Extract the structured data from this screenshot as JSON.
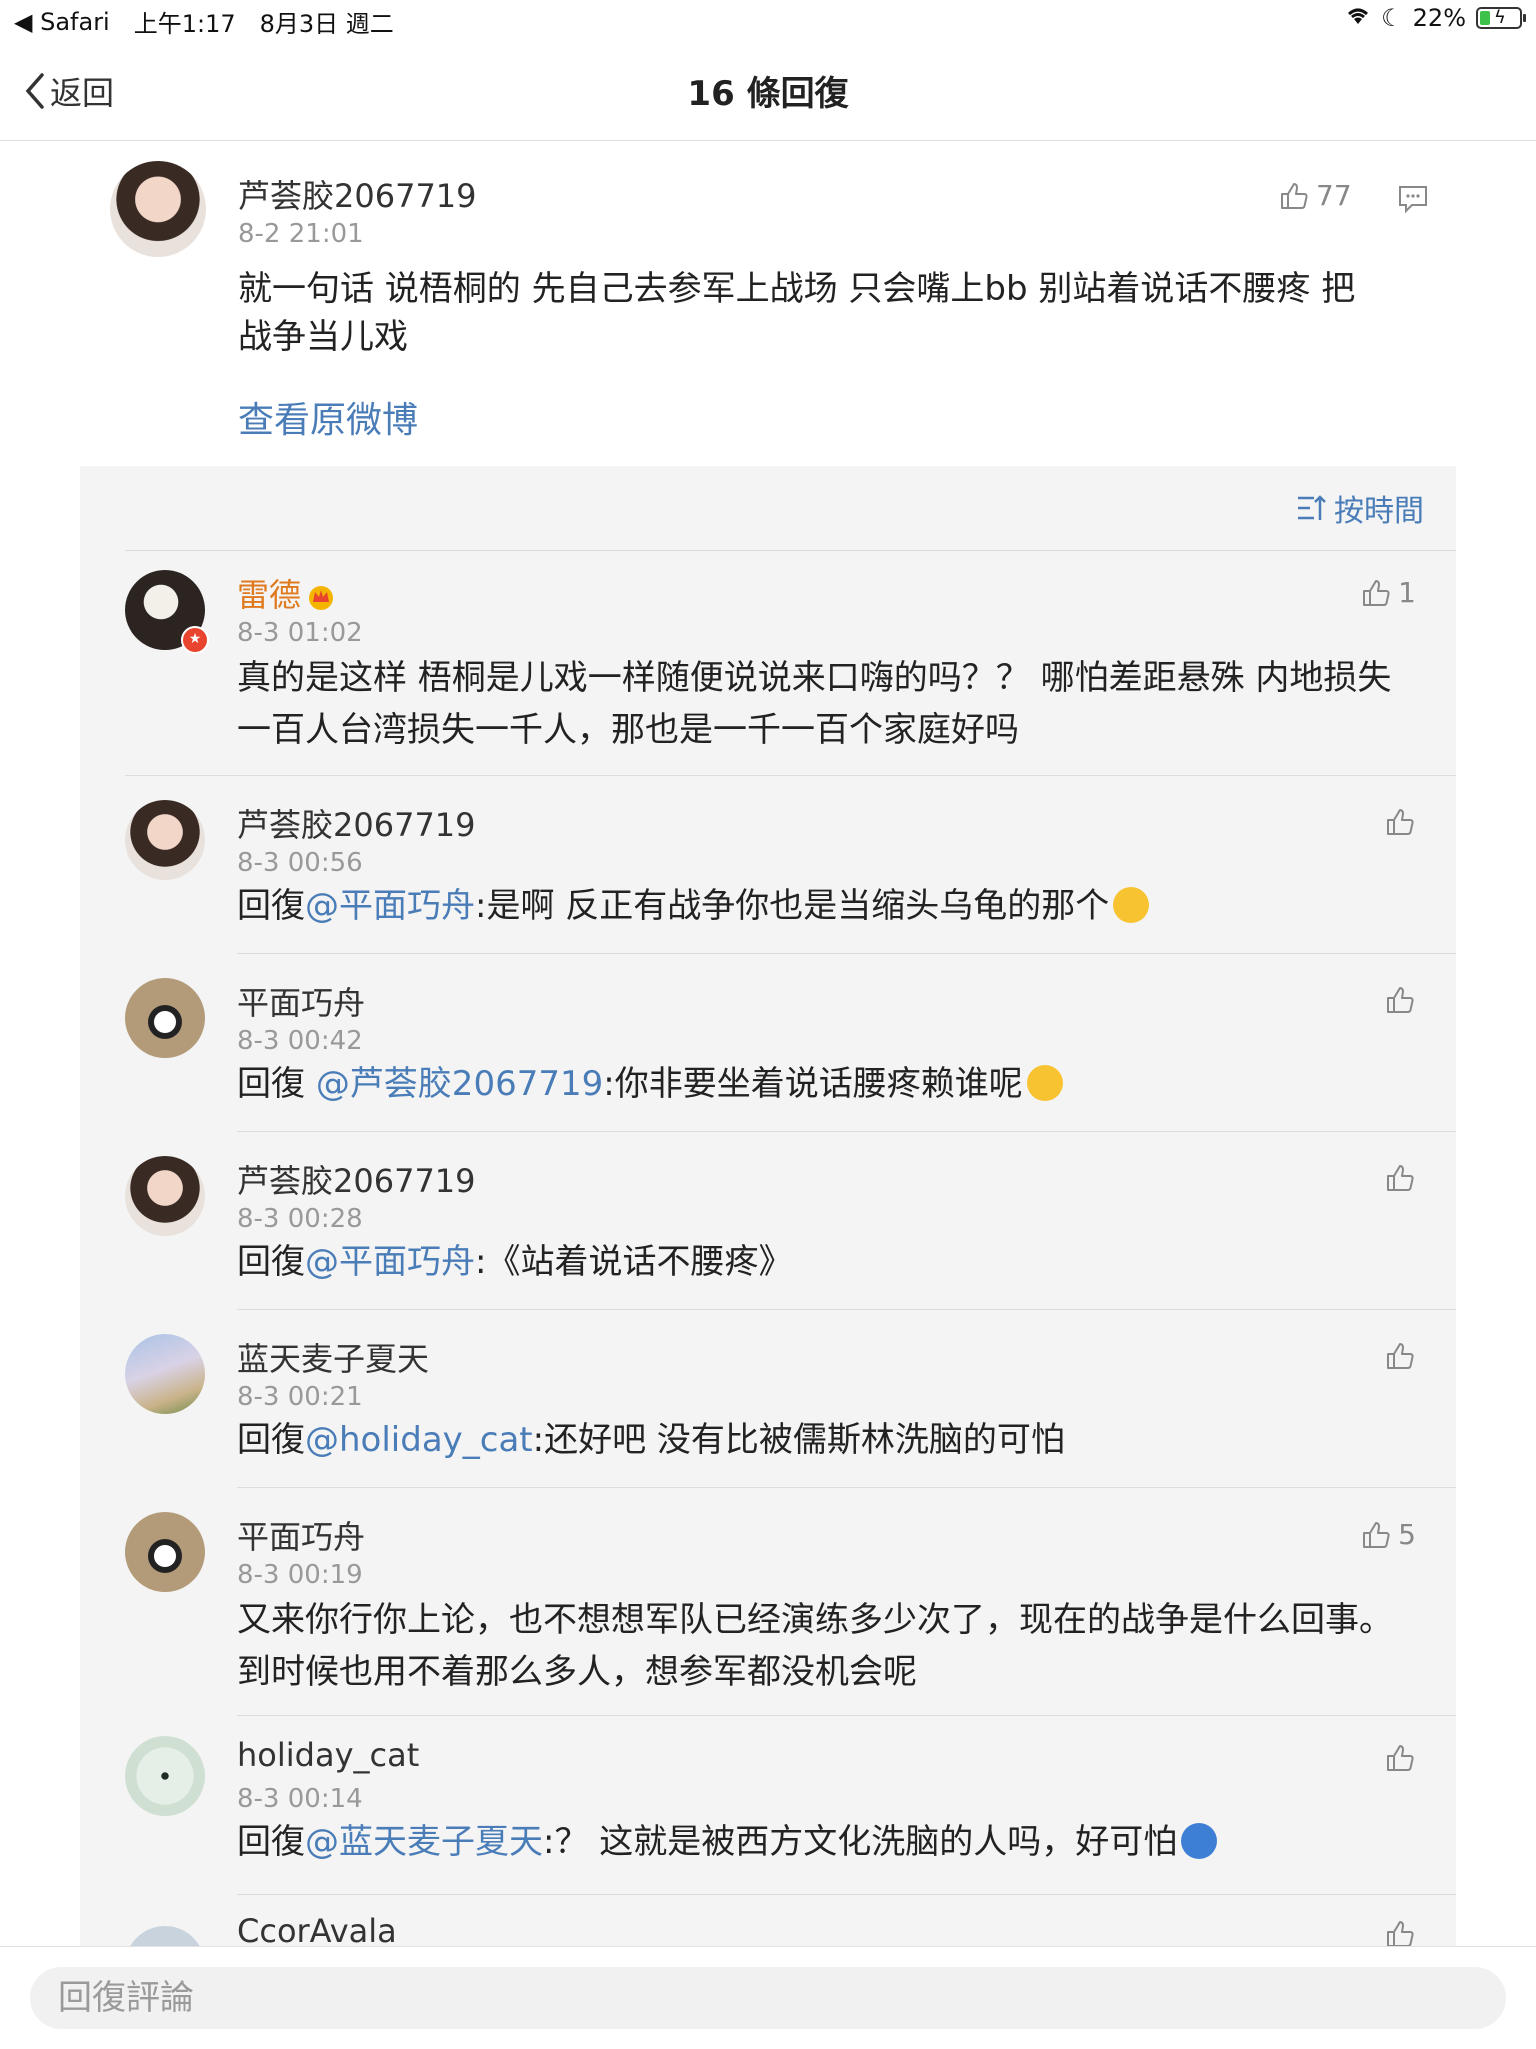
{
  "status_bar": {
    "app": "Safari",
    "time": "上午1:17",
    "date": "8月3日 週二",
    "battery": "22%"
  },
  "nav": {
    "back_label": "返回",
    "title": "16 條回復"
  },
  "main_comment": {
    "username": "芦荟胶2067719",
    "time": "8-2 21:01",
    "likes": "77",
    "text": "就一句话 说梧桐的 先自己去参军上战场 只会嘴上bb 别站着说话不腰疼 把战争当儿戏",
    "view_original": "查看原微博"
  },
  "sort_label": "按時間",
  "replies": [
    {
      "username": "雷德",
      "time": "8-3 01:02",
      "likes": "1",
      "text": "真的是这样 梧桐是儿戏一样随便说说来口嗨的吗？？ 哪怕差距悬殊 内地损失一百人台湾损失一千人，那也是一千一百个家庭好吗"
    },
    {
      "username": "芦荟胶2067719",
      "time": "8-3 00:56",
      "likes": "",
      "prefix": "回復",
      "mention": "@平面巧舟",
      "text": ":是啊 反正有战争你也是当缩头乌龟的那个"
    },
    {
      "username": "平面巧舟",
      "time": "8-3 00:42",
      "likes": "",
      "prefix": "回復 ",
      "mention": "@芦荟胶2067719",
      "text": ":你非要坐着说话腰疼赖谁呢"
    },
    {
      "username": "芦荟胶2067719",
      "time": "8-3 00:28",
      "likes": "",
      "prefix": "回復",
      "mention": "@平面巧舟",
      "text": ":《站着说话不腰疼》"
    },
    {
      "username": "蓝天麦子夏天",
      "time": "8-3 00:21",
      "likes": "",
      "prefix": "回復",
      "mention": "@holiday_cat",
      "text": ":还好吧 没有比被儒斯林洗脑的可怕"
    },
    {
      "username": "平面巧舟",
      "time": "8-3 00:19",
      "likes": "5",
      "text": "又来你行你上论，也不想想军队已经演练多少次了，现在的战争是什么回事。到时候也用不着那么多人，想参军都没机会呢"
    },
    {
      "username": "holiday_cat",
      "time": "8-3 00:14",
      "likes": "",
      "prefix": "回復",
      "mention": "@蓝天麦子夏天",
      "text": ":？ 这就是被西方文化洗脑的人吗，好可怕"
    },
    {
      "username": "CcorAvala"
    }
  ],
  "bottom": {
    "placeholder": "回復評論"
  },
  "colors": {
    "link": "#4a7db8",
    "vip_name": "#e07a1f",
    "panel_bg": "#f4f4f4"
  }
}
